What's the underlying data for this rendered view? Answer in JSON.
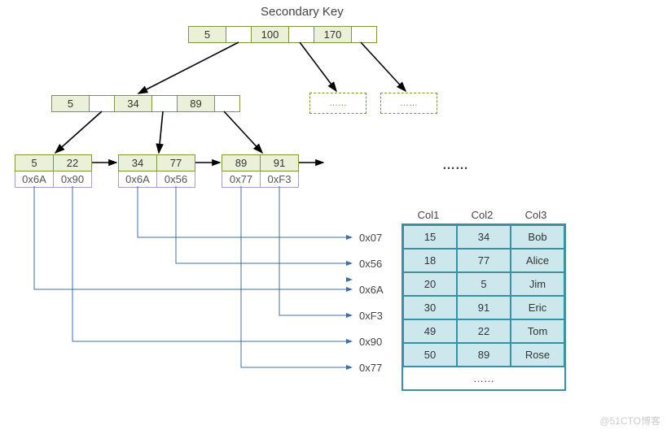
{
  "title": "Secondary Key",
  "root": {
    "cells": [
      "5",
      "",
      "100",
      "",
      "170",
      ""
    ]
  },
  "mid": {
    "cells": [
      "5",
      "",
      "34",
      "",
      "89",
      ""
    ]
  },
  "mid_dashed": [
    "……",
    "……"
  ],
  "leaves": [
    {
      "keys": [
        "5",
        "22"
      ],
      "ptrs": [
        "0x6A",
        "0x90"
      ]
    },
    {
      "keys": [
        "34",
        "77"
      ],
      "ptrs": [
        "0x6A",
        "0x56"
      ]
    },
    {
      "keys": [
        "89",
        "91"
      ],
      "ptrs": [
        "0x77",
        "0xF3"
      ]
    }
  ],
  "leaf_ellipsis": "……",
  "addrs": [
    "0x07",
    "0x56",
    "0x6A",
    "0xF3",
    "0x90",
    "0x77"
  ],
  "table": {
    "cols": [
      "Col1",
      "Col2",
      "Col3"
    ],
    "rows": [
      [
        "15",
        "34",
        "Bob"
      ],
      [
        "18",
        "77",
        "Alice"
      ],
      [
        "20",
        "5",
        "Jim"
      ],
      [
        "30",
        "91",
        "Eric"
      ],
      [
        "49",
        "22",
        "Tom"
      ],
      [
        "50",
        "89",
        "Rose"
      ]
    ],
    "footer": "……"
  },
  "watermark": "@51CTO博客"
}
